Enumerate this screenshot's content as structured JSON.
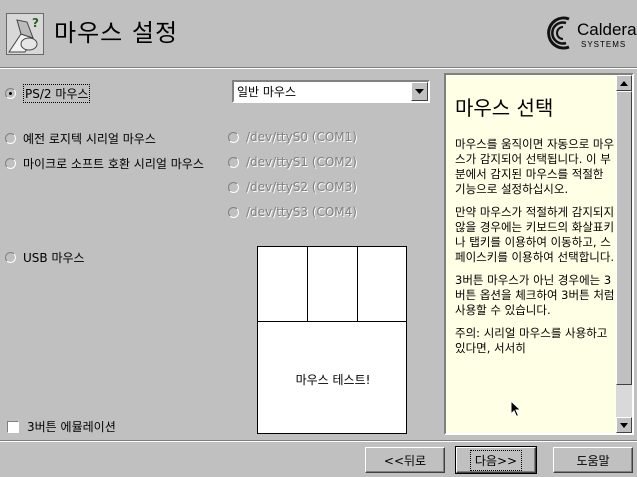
{
  "header": {
    "title": "마우스 설정"
  },
  "logo": {
    "word": "Caldera",
    "sub": "SYSTEMS"
  },
  "mouse_types": {
    "ps2": {
      "label": "PS/2 마우스",
      "selected": true
    },
    "logitech_serial": {
      "label": "예전 로지텍 시리얼 마우스"
    },
    "ms_serial": {
      "label": "마이크로 소프트 호환 시리얼 마우스"
    },
    "usb": {
      "label": "USB 마우스"
    }
  },
  "mouse_select": {
    "value": "일반 마우스"
  },
  "serial_ports": [
    {
      "label": "/dev/ttyS0 (COM1)"
    },
    {
      "label": "/dev/ttyS1 (COM2)"
    },
    {
      "label": "/dev/ttyS2 (COM3)"
    },
    {
      "label": "/dev/ttyS3 (COM4)"
    }
  ],
  "mouse_test": {
    "label": "마우스 테스트!"
  },
  "emulation": {
    "label": "3버튼 에뮬레이션",
    "checked": false
  },
  "help": {
    "title": "마우스 선택",
    "paragraphs": [
      "마우스를 움직이면 자동으로 마우스가 감지되어 선택됩니다. 이 부분에서 감지된 마우스를 적절한 기능으로 설정하십시오.",
      "만약 마우스가 적절하게 감지되지 않을 경우에는 키보드의 화살표키나 탭키를 이용하여 이동하고, 스페이스키를 이용하여 선택합니다.",
      "3버튼 마우스가 아닌 경우에는 3버튼 옵션을 체크하여 3버튼 처럼 사용할 수 있습니다.",
      "주의: 시리얼 마우스를 사용하고 있다면, 서서히"
    ]
  },
  "nav": {
    "back_label": "<<뒤로",
    "next_label": "다음>>",
    "help_label": "도움말"
  }
}
